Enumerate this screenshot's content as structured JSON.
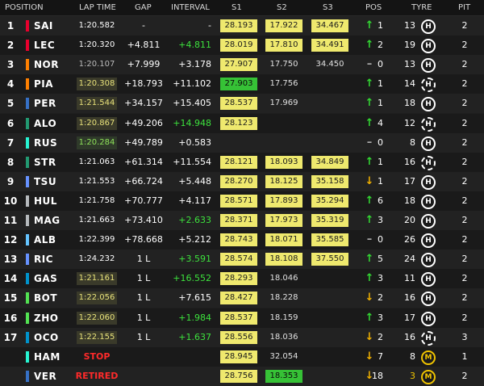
{
  "header": {
    "position": "POSITION",
    "lap_time": "LAP TIME",
    "gap": "GAP",
    "interval": "INTERVAL",
    "s1": "S1",
    "s2": "S2",
    "s3": "S3",
    "pos": "POS",
    "tyre": "TYRE",
    "pit": "PIT"
  },
  "colors": {
    "sector_yellow": "#efe96e",
    "sector_green": "#36c236",
    "interval_green": "#3de23d",
    "arrow_up": "#33d933",
    "arrow_down": "#f0b000",
    "status_red": "#ff2a2a"
  },
  "rows": [
    {
      "pos": "1",
      "team_color": "#e8002d",
      "driver": "SAI",
      "lap": "1:20.582",
      "lap_style": "plain",
      "gap": "-",
      "interval": "-",
      "interval_green": false,
      "s1": "28.193",
      "s1_style": "yellow",
      "s2": "17.922",
      "s2_style": "yellow",
      "s3": "34.467",
      "s3_style": "yellow",
      "arrow": "↑",
      "arrow_dir": "up",
      "pos_change": "1",
      "tyre_laps": "13",
      "tyre_laps_style": "plain",
      "tyre_compound": "H",
      "tyre_used": false,
      "pit": "2"
    },
    {
      "pos": "2",
      "team_color": "#e8002d",
      "driver": "LEC",
      "lap": "1:20.320",
      "lap_style": "plain",
      "gap": "+4.811",
      "interval": "+4.811",
      "interval_green": true,
      "s1": "28.019",
      "s1_style": "yellow",
      "s2": "17.810",
      "s2_style": "yellow",
      "s3": "34.491",
      "s3_style": "yellow",
      "arrow": "↑",
      "arrow_dir": "up",
      "pos_change": "2",
      "tyre_laps": "19",
      "tyre_laps_style": "plain",
      "tyre_compound": "H",
      "tyre_used": false,
      "pit": "2"
    },
    {
      "pos": "3",
      "team_color": "#ff8000",
      "driver": "NOR",
      "lap": "1:20.107",
      "lap_style": "grey",
      "gap": "+7.999",
      "interval": "+3.178",
      "interval_green": false,
      "s1": "27.907",
      "s1_style": "yellow",
      "s2": "17.750",
      "s2_style": "plain",
      "s3": "34.450",
      "s3_style": "plain",
      "arrow": "–",
      "arrow_dir": "none",
      "pos_change": "0",
      "tyre_laps": "13",
      "tyre_laps_style": "plain",
      "tyre_compound": "H",
      "tyre_used": false,
      "pit": "2"
    },
    {
      "pos": "4",
      "team_color": "#ff8000",
      "driver": "PIA",
      "lap": "1:20.308",
      "lap_style": "yellow",
      "gap": "+18.793",
      "interval": "+11.102",
      "interval_green": false,
      "s1": "27.903",
      "s1_style": "green",
      "s2": "17.756",
      "s2_style": "plain",
      "s3": "",
      "s3_style": "none",
      "arrow": "↑",
      "arrow_dir": "up",
      "pos_change": "1",
      "tyre_laps": "14",
      "tyre_laps_style": "plain",
      "tyre_compound": "H",
      "tyre_used": true,
      "pit": "2"
    },
    {
      "pos": "5",
      "team_color": "#3671c6",
      "driver": "PER",
      "lap": "1:21.544",
      "lap_style": "yellow",
      "gap": "+34.157",
      "interval": "+15.405",
      "interval_green": false,
      "s1": "28.537",
      "s1_style": "yellow",
      "s2": "17.969",
      "s2_style": "plain",
      "s3": "",
      "s3_style": "none",
      "arrow": "↑",
      "arrow_dir": "up",
      "pos_change": "1",
      "tyre_laps": "18",
      "tyre_laps_style": "plain",
      "tyre_compound": "H",
      "tyre_used": false,
      "pit": "2"
    },
    {
      "pos": "6",
      "team_color": "#229971",
      "driver": "ALO",
      "lap": "1:20.867",
      "lap_style": "yellow",
      "gap": "+49.206",
      "interval": "+14.948",
      "interval_green": true,
      "s1": "28.123",
      "s1_style": "yellow",
      "s2": "",
      "s2_style": "none",
      "s3": "",
      "s3_style": "none",
      "arrow": "↑",
      "arrow_dir": "up",
      "pos_change": "4",
      "tyre_laps": "12",
      "tyre_laps_style": "plain",
      "tyre_compound": "H",
      "tyre_used": true,
      "pit": "2"
    },
    {
      "pos": "7",
      "team_color": "#27f4d2",
      "driver": "RUS",
      "lap": "1:20.284",
      "lap_style": "green",
      "gap": "+49.789",
      "interval": "+0.583",
      "interval_green": false,
      "s1": "",
      "s1_style": "none",
      "s2": "",
      "s2_style": "none",
      "s3": "",
      "s3_style": "none",
      "arrow": "–",
      "arrow_dir": "none",
      "pos_change": "0",
      "tyre_laps": "8",
      "tyre_laps_style": "plain",
      "tyre_compound": "H",
      "tyre_used": false,
      "pit": "2"
    },
    {
      "pos": "8",
      "team_color": "#229971",
      "driver": "STR",
      "lap": "1:21.063",
      "lap_style": "plain",
      "gap": "+61.314",
      "interval": "+11.554",
      "interval_green": false,
      "s1": "28.121",
      "s1_style": "yellow",
      "s2": "18.093",
      "s2_style": "yellow",
      "s3": "34.849",
      "s3_style": "yellow",
      "arrow": "↑",
      "arrow_dir": "up",
      "pos_change": "1",
      "tyre_laps": "16",
      "tyre_laps_style": "plain",
      "tyre_compound": "H",
      "tyre_used": true,
      "pit": "2"
    },
    {
      "pos": "9",
      "team_color": "#6692ff",
      "driver": "TSU",
      "lap": "1:21.553",
      "lap_style": "plain",
      "gap": "+66.724",
      "interval": "+5.448",
      "interval_green": false,
      "s1": "28.270",
      "s1_style": "yellow",
      "s2": "18.125",
      "s2_style": "yellow",
      "s3": "35.158",
      "s3_style": "yellow",
      "arrow": "↓",
      "arrow_dir": "down",
      "pos_change": "1",
      "tyre_laps": "17",
      "tyre_laps_style": "plain",
      "tyre_compound": "H",
      "tyre_used": false,
      "pit": "2"
    },
    {
      "pos": "10",
      "team_color": "#b6babd",
      "driver": "HUL",
      "lap": "1:21.758",
      "lap_style": "plain",
      "gap": "+70.777",
      "interval": "+4.117",
      "interval_green": false,
      "s1": "28.571",
      "s1_style": "yellow",
      "s2": "17.893",
      "s2_style": "yellow",
      "s3": "35.294",
      "s3_style": "yellow",
      "arrow": "↑",
      "arrow_dir": "up",
      "pos_change": "6",
      "tyre_laps": "18",
      "tyre_laps_style": "plain",
      "tyre_compound": "H",
      "tyre_used": false,
      "pit": "2"
    },
    {
      "pos": "11",
      "team_color": "#b6babd",
      "driver": "MAG",
      "lap": "1:21.663",
      "lap_style": "plain",
      "gap": "+73.410",
      "interval": "+2.633",
      "interval_green": true,
      "s1": "28.371",
      "s1_style": "yellow",
      "s2": "17.973",
      "s2_style": "yellow",
      "s3": "35.319",
      "s3_style": "yellow",
      "arrow": "↑",
      "arrow_dir": "up",
      "pos_change": "3",
      "tyre_laps": "20",
      "tyre_laps_style": "plain",
      "tyre_compound": "H",
      "tyre_used": false,
      "pit": "2"
    },
    {
      "pos": "12",
      "team_color": "#64c4ff",
      "driver": "ALB",
      "lap": "1:22.399",
      "lap_style": "plain",
      "gap": "+78.668",
      "interval": "+5.212",
      "interval_green": false,
      "s1": "28.743",
      "s1_style": "yellow",
      "s2": "18.071",
      "s2_style": "yellow",
      "s3": "35.585",
      "s3_style": "yellow",
      "arrow": "–",
      "arrow_dir": "none",
      "pos_change": "0",
      "tyre_laps": "26",
      "tyre_laps_style": "plain",
      "tyre_compound": "H",
      "tyre_used": false,
      "pit": "2"
    },
    {
      "pos": "13",
      "team_color": "#6692ff",
      "driver": "RIC",
      "lap": "1:24.232",
      "lap_style": "plain",
      "gap": "1 L",
      "interval": "+3.591",
      "interval_green": true,
      "s1": "28.574",
      "s1_style": "yellow",
      "s2": "18.108",
      "s2_style": "yellow",
      "s3": "37.550",
      "s3_style": "yellow",
      "arrow": "↑",
      "arrow_dir": "up",
      "pos_change": "5",
      "tyre_laps": "24",
      "tyre_laps_style": "plain",
      "tyre_compound": "H",
      "tyre_used": false,
      "pit": "2"
    },
    {
      "pos": "14",
      "team_color": "#0093cc",
      "driver": "GAS",
      "lap": "1:21.161",
      "lap_style": "yellow",
      "gap": "1 L",
      "interval": "+16.552",
      "interval_green": true,
      "s1": "28.293",
      "s1_style": "yellow",
      "s2": "18.046",
      "s2_style": "plain",
      "s3": "",
      "s3_style": "none",
      "arrow": "↑",
      "arrow_dir": "up",
      "pos_change": "3",
      "tyre_laps": "11",
      "tyre_laps_style": "plain",
      "tyre_compound": "H",
      "tyre_used": false,
      "pit": "2"
    },
    {
      "pos": "15",
      "team_color": "#52e252",
      "driver": "BOT",
      "lap": "1:22.056",
      "lap_style": "yellow",
      "gap": "1 L",
      "interval": "+7.615",
      "interval_green": false,
      "s1": "28.427",
      "s1_style": "yellow",
      "s2": "18.228",
      "s2_style": "plain",
      "s3": "",
      "s3_style": "none",
      "arrow": "↓",
      "arrow_dir": "down",
      "pos_change": "2",
      "tyre_laps": "16",
      "tyre_laps_style": "plain",
      "tyre_compound": "H",
      "tyre_used": false,
      "pit": "2"
    },
    {
      "pos": "16",
      "team_color": "#52e252",
      "driver": "ZHO",
      "lap": "1:22.060",
      "lap_style": "yellow",
      "gap": "1 L",
      "interval": "+1.984",
      "interval_green": true,
      "s1": "28.537",
      "s1_style": "yellow",
      "s2": "18.159",
      "s2_style": "plain",
      "s3": "",
      "s3_style": "none",
      "arrow": "↑",
      "arrow_dir": "up",
      "pos_change": "3",
      "tyre_laps": "17",
      "tyre_laps_style": "plain",
      "tyre_compound": "H",
      "tyre_used": false,
      "pit": "2"
    },
    {
      "pos": "17",
      "team_color": "#0093cc",
      "driver": "OCO",
      "lap": "1:22.155",
      "lap_style": "yellow",
      "gap": "1 L",
      "interval": "+1.637",
      "interval_green": true,
      "s1": "28.556",
      "s1_style": "yellow",
      "s2": "18.036",
      "s2_style": "plain",
      "s3": "",
      "s3_style": "none",
      "arrow": "↓",
      "arrow_dir": "down",
      "pos_change": "2",
      "tyre_laps": "16",
      "tyre_laps_style": "plain",
      "tyre_compound": "H",
      "tyre_used": true,
      "pit": "3"
    },
    {
      "pos": "",
      "team_color": "#27f4d2",
      "driver": "HAM",
      "lap": "STOP",
      "lap_style": "status",
      "gap": "",
      "interval": "",
      "interval_green": false,
      "s1": "28.945",
      "s1_style": "yellow",
      "s2": "32.054",
      "s2_style": "plain",
      "s3": "",
      "s3_style": "none",
      "arrow": "↓",
      "arrow_dir": "down",
      "pos_change": "7",
      "tyre_laps": "8",
      "tyre_laps_style": "plain",
      "tyre_compound": "M",
      "tyre_used": false,
      "pit": "1"
    },
    {
      "pos": "",
      "team_color": "#3671c6",
      "driver": "VER",
      "lap": "RETIRED",
      "lap_style": "status",
      "gap": "",
      "interval": "",
      "interval_green": false,
      "s1": "28.756",
      "s1_style": "yellow",
      "s2": "18.353",
      "s2_style": "green",
      "s3": "",
      "s3_style": "none",
      "arrow": "↓",
      "arrow_dir": "down",
      "pos_change": "18",
      "tyre_laps": "3",
      "tyre_laps_style": "yellow",
      "tyre_compound": "M",
      "tyre_used": false,
      "pit": "2"
    }
  ]
}
